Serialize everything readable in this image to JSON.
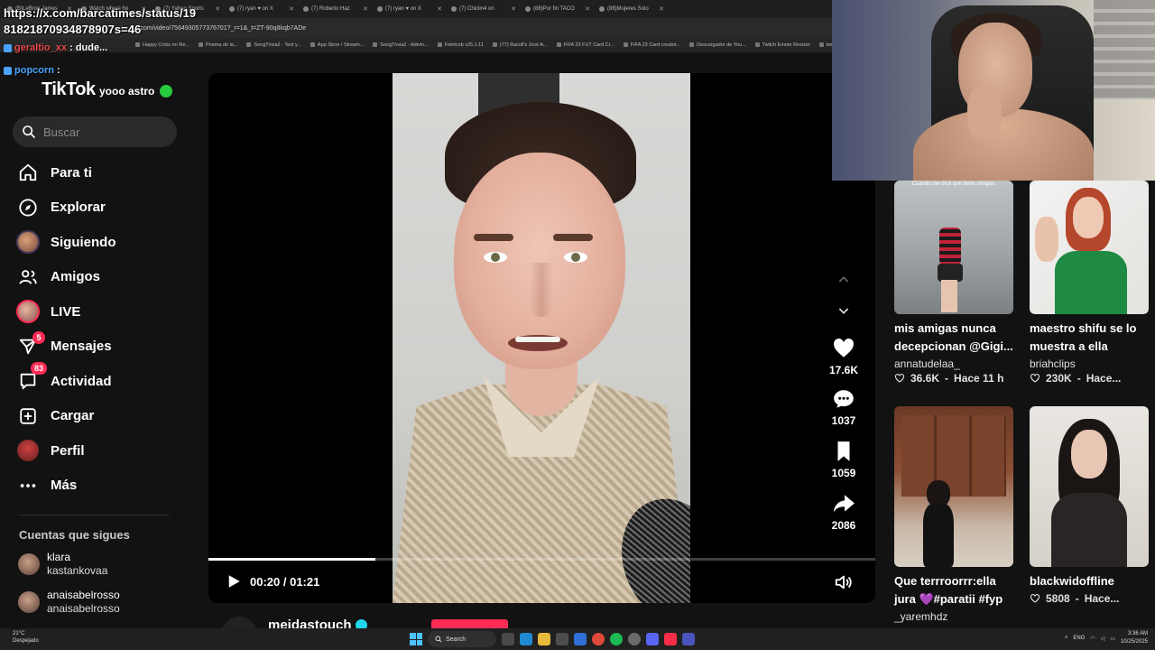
{
  "browser": {
    "tabs": [
      "(B)LeBron James",
      "Watch where ho",
      "(7) Yahoo Sports",
      "(7) ryan ♥ on X",
      "(7) Roberto Haz",
      "(7) ryan ♥ on X",
      "(7) Chiclin4 on",
      "(88)Por fin TACO",
      "(88)Mujeres Solo"
    ],
    "url": "x.com/video/7564930577376701?_r=1&_t=ZT-90q8kqb7ADe",
    "bookmarks": [
      "Happy Crisis en Re...",
      "Poema de la...",
      "SongTrivia2 - Test y...",
      "App Store / Stream...",
      "SongTrivia2 - Adivin...",
      "Feletcob v25.1.11",
      "(77) Racoll's Zest-A...",
      "FIFA 23 FUT Card Cr...",
      "FIFA 23 Card creator...",
      "Descargador de You...",
      "Twitch Emote Resizer",
      "twitch emote resiz..."
    ]
  },
  "stream_chat": {
    "url_line1": "https://x.com/barcatimes/status/19",
    "url_line2": "81821870934878907s=46",
    "line1_user": "geraltio_xx",
    "line1_msg": ": dude...",
    "line2_user": "popcorn",
    "line2_msg": ":",
    "line3_msg": "yooo astro"
  },
  "sidebar": {
    "logo": "TikTok",
    "search_placeholder": "Buscar",
    "items": [
      {
        "label": "Para ti",
        "icon": "home-icon"
      },
      {
        "label": "Explorar",
        "icon": "compass-icon"
      },
      {
        "label": "Siguiendo",
        "icon": "following-avatar-icon"
      },
      {
        "label": "Amigos",
        "icon": "friends-icon"
      },
      {
        "label": "LIVE",
        "icon": "live-avatar-icon"
      },
      {
        "label": "Mensajes",
        "icon": "messages-icon",
        "badge": "5"
      },
      {
        "label": "Actividad",
        "icon": "activity-icon",
        "badge": "83"
      },
      {
        "label": "Cargar",
        "icon": "upload-icon"
      },
      {
        "label": "Perfil",
        "icon": "profile-avatar-icon"
      },
      {
        "label": "Más",
        "icon": "more-icon"
      }
    ],
    "following_header": "Cuentas que sigues",
    "following": [
      {
        "line1": "klara",
        "line2": "kastankovaa"
      },
      {
        "line1": "anaisabelrosso",
        "line2": "anaisabelrosso"
      }
    ]
  },
  "player": {
    "time": "00:20 / 01:21",
    "progress": 0.25,
    "author": "meidastouch",
    "likes": "17.6K",
    "comments": "1037",
    "saves": "1059",
    "shares": "2086"
  },
  "suggestions": [
    {
      "caption": "Cuando me dice que tiene amigas:",
      "title": "mis amigas nunca decepcionan @Gigi...",
      "user": "annatudelaa_",
      "likes": "36.6K",
      "age": "Hace 11 h"
    },
    {
      "caption": "",
      "title": "maestro shifu se lo muestra a ella",
      "user": "briahclips",
      "likes": "230K",
      "age": "Hace..."
    },
    {
      "caption": "",
      "title": "Que terrroorrr:ella jura 💜#paratii #fyp",
      "user": "_yaremhdz",
      "likes": "",
      "age": ""
    },
    {
      "caption": "",
      "title": "blackwidoffline",
      "user": "",
      "likes": "5808",
      "age": "Hace..."
    }
  ],
  "taskbar": {
    "weather_temp": "21°C",
    "weather_desc": "Despejado",
    "search_label": "Search",
    "lang": "ENG",
    "time": "3:36 AM",
    "date": "10/25/2025"
  },
  "colors": {
    "accent": "#fe2c55",
    "background": "#121212",
    "verified": "#20d5ec"
  }
}
